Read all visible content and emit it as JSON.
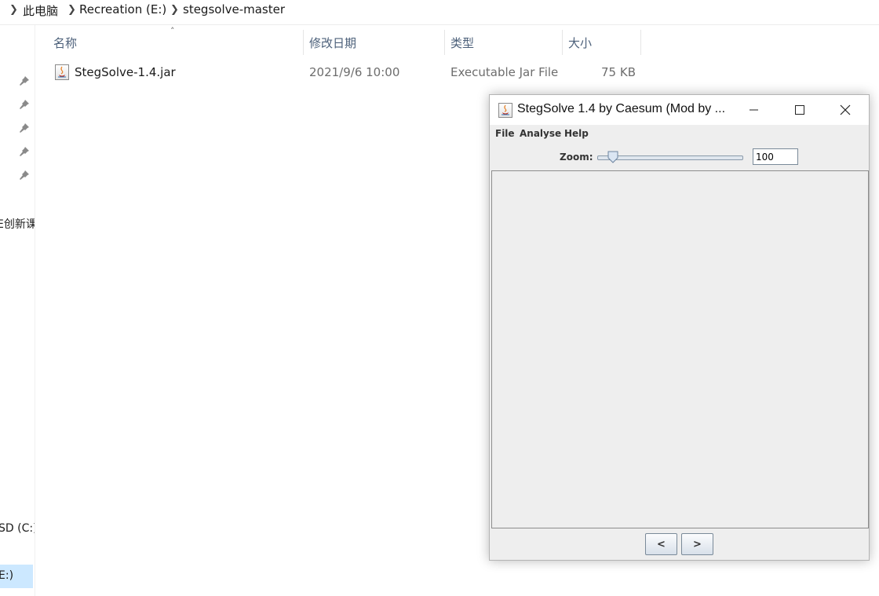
{
  "explorer": {
    "breadcrumbs": [
      "此电脑",
      "Recreation (E:)",
      "stegsolve-master"
    ],
    "columns": {
      "name": "名称",
      "modified": "修改日期",
      "type": "类型",
      "size": "大小"
    },
    "files": [
      {
        "name": "StegSolve-1.4.jar",
        "modified": "2021/9/6 10:00",
        "type": "Executable Jar File",
        "size": "75 KB"
      }
    ],
    "nav_items": [
      "E创新课",
      "E",
      "SD (C:)",
      "E:)"
    ]
  },
  "stegsolve": {
    "title": "StegSolve 1.4 by Caesum (Mod by ...",
    "menu": [
      "File",
      "Analyse",
      "Help"
    ],
    "zoom_label": "Zoom:",
    "zoom_value": "100",
    "zoom_slider_fraction": 0.1,
    "prev_label": "<",
    "next_label": ">"
  }
}
